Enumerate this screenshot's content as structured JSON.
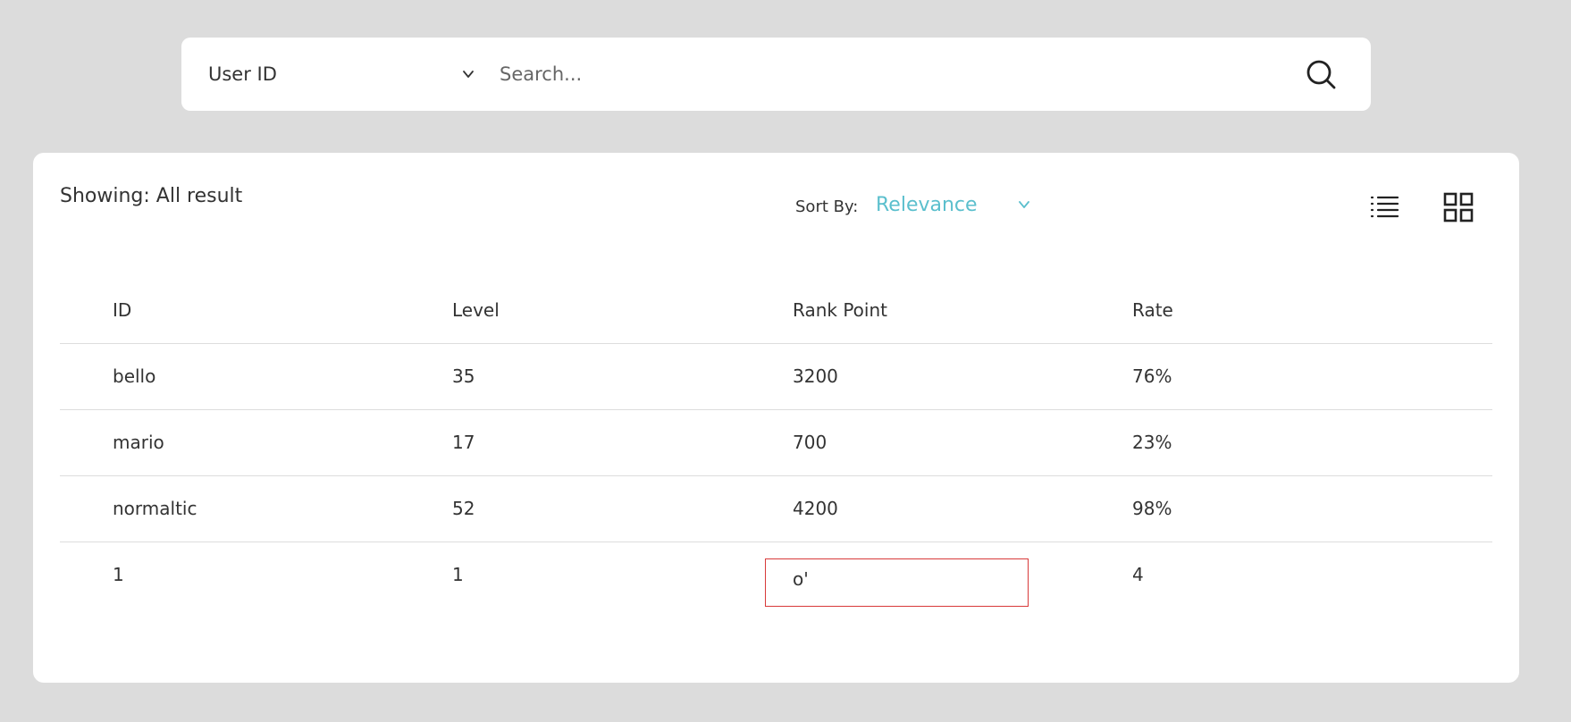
{
  "search": {
    "filter_value": "User ID",
    "placeholder": "Search...",
    "query": ""
  },
  "results": {
    "showing_text": "Showing: All result",
    "sort_label": "Sort By:",
    "sort_value": "Relevance",
    "view_icons": [
      "list-view-icon",
      "grid-view-icon"
    ]
  },
  "table": {
    "columns": [
      "ID",
      "Level",
      "Rank Point",
      "Rate"
    ],
    "rows": [
      [
        "bello",
        "35",
        "3200",
        "76%"
      ],
      [
        "mario",
        "17",
        "700",
        "23%"
      ],
      [
        "normaltic",
        "52",
        "4200",
        "98%"
      ],
      [
        "1",
        "1",
        "o'",
        "4"
      ]
    ]
  },
  "colors": {
    "page_bg": "#dcdcdc",
    "accent": "#5bbfcd",
    "edit_border": "#d83a3a"
  }
}
